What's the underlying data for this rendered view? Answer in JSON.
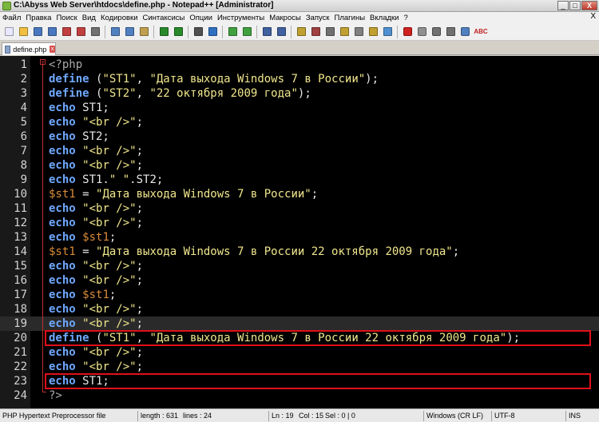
{
  "window": {
    "title": "C:\\Abyss Web Server\\htdocs\\define.php - Notepad++ [Administrator]",
    "buttons": [
      "_",
      "□",
      "X"
    ]
  },
  "menu": [
    "Файл",
    "Правка",
    "Поиск",
    "Вид",
    "Кодировки",
    "Синтаксисы",
    "Опции",
    "Инструменты",
    "Макросы",
    "Запуск",
    "Плагины",
    "Вкладки",
    "?"
  ],
  "menu_close": "X",
  "toolbar": {
    "icons": [
      "new-file-icon",
      "open-file-icon",
      "save-icon",
      "save-all-icon",
      "close-icon",
      "close-all-icon",
      "print-icon",
      "cut-icon",
      "copy-icon",
      "paste-icon",
      "undo-icon",
      "redo-icon",
      "find-icon",
      "replace-icon",
      "zoom-in-icon",
      "zoom-out-icon",
      "sync-v-icon",
      "sync-h-icon",
      "word-wrap-icon",
      "show-all-icon",
      "indent-guide-icon",
      "doc-map-icon",
      "function-list-icon",
      "folder-icon",
      "monitor-icon",
      "record-macro-icon",
      "stop-macro-icon",
      "play-macro-icon",
      "play-multi-icon",
      "save-macro-icon",
      "spellcheck-icon"
    ],
    "spellcheck_label": "ABC"
  },
  "tab": {
    "label": "define.php"
  },
  "editor": {
    "current_line": 19,
    "lines": [
      {
        "n": "1",
        "tokens": [
          [
            "phptag",
            "<?php"
          ]
        ]
      },
      {
        "n": "2",
        "tokens": [
          [
            "kw",
            "define"
          ],
          [
            "plain",
            " ("
          ],
          [
            "str",
            "\"ST1\""
          ],
          [
            "plain",
            ", "
          ],
          [
            "str",
            "\"Дата выхода Windows 7 в России\""
          ],
          [
            "plain",
            ");"
          ]
        ]
      },
      {
        "n": "3",
        "tokens": [
          [
            "kw",
            "define"
          ],
          [
            "plain",
            " ("
          ],
          [
            "str",
            "\"ST2\""
          ],
          [
            "plain",
            ", "
          ],
          [
            "str",
            "\"22 октября 2009 года\""
          ],
          [
            "plain",
            ");"
          ]
        ]
      },
      {
        "n": "4",
        "tokens": [
          [
            "kw",
            "echo"
          ],
          [
            "plain",
            " ST1;"
          ]
        ]
      },
      {
        "n": "5",
        "tokens": [
          [
            "kw",
            "echo"
          ],
          [
            "plain",
            " "
          ],
          [
            "str",
            "\"<br />\""
          ],
          [
            "plain",
            ";"
          ]
        ]
      },
      {
        "n": "6",
        "tokens": [
          [
            "kw",
            "echo"
          ],
          [
            "plain",
            " ST2;"
          ]
        ]
      },
      {
        "n": "7",
        "tokens": [
          [
            "kw",
            "echo"
          ],
          [
            "plain",
            " "
          ],
          [
            "str",
            "\"<br />\""
          ],
          [
            "plain",
            ";"
          ]
        ]
      },
      {
        "n": "8",
        "tokens": [
          [
            "kw",
            "echo"
          ],
          [
            "plain",
            " "
          ],
          [
            "str",
            "\"<br />\""
          ],
          [
            "plain",
            ";"
          ]
        ]
      },
      {
        "n": "9",
        "tokens": [
          [
            "kw",
            "echo"
          ],
          [
            "plain",
            " ST1."
          ],
          [
            "str",
            "\" \""
          ],
          [
            "plain",
            ".ST2;"
          ]
        ]
      },
      {
        "n": "10",
        "tokens": [
          [
            "var",
            "$st1"
          ],
          [
            "plain",
            " = "
          ],
          [
            "str",
            "\"Дата выхода Windows 7 в России\""
          ],
          [
            "plain",
            ";"
          ]
        ]
      },
      {
        "n": "11",
        "tokens": [
          [
            "kw",
            "echo"
          ],
          [
            "plain",
            " "
          ],
          [
            "str",
            "\"<br />\""
          ],
          [
            "plain",
            ";"
          ]
        ]
      },
      {
        "n": "12",
        "tokens": [
          [
            "kw",
            "echo"
          ],
          [
            "plain",
            " "
          ],
          [
            "str",
            "\"<br />\""
          ],
          [
            "plain",
            ";"
          ]
        ]
      },
      {
        "n": "13",
        "tokens": [
          [
            "kw",
            "echo"
          ],
          [
            "plain",
            " "
          ],
          [
            "var",
            "$st1"
          ],
          [
            "plain",
            ";"
          ]
        ]
      },
      {
        "n": "14",
        "tokens": [
          [
            "var",
            "$st1"
          ],
          [
            "plain",
            " = "
          ],
          [
            "str",
            "\"Дата выхода Windows 7 в России 22 октября 2009 года\""
          ],
          [
            "plain",
            ";"
          ]
        ]
      },
      {
        "n": "15",
        "tokens": [
          [
            "kw",
            "echo"
          ],
          [
            "plain",
            " "
          ],
          [
            "str",
            "\"<br />\""
          ],
          [
            "plain",
            ";"
          ]
        ]
      },
      {
        "n": "16",
        "tokens": [
          [
            "kw",
            "echo"
          ],
          [
            "plain",
            " "
          ],
          [
            "str",
            "\"<br />\""
          ],
          [
            "plain",
            ";"
          ]
        ]
      },
      {
        "n": "17",
        "tokens": [
          [
            "kw",
            "echo"
          ],
          [
            "plain",
            " "
          ],
          [
            "var",
            "$st1"
          ],
          [
            "plain",
            ";"
          ]
        ]
      },
      {
        "n": "18",
        "tokens": [
          [
            "kw",
            "echo"
          ],
          [
            "plain",
            " "
          ],
          [
            "str",
            "\"<br />\""
          ],
          [
            "plain",
            ";"
          ]
        ]
      },
      {
        "n": "19",
        "tokens": [
          [
            "kw",
            "echo"
          ],
          [
            "plain",
            " "
          ],
          [
            "str",
            "\"<br />\""
          ],
          [
            "plain",
            ";"
          ]
        ]
      },
      {
        "n": "20",
        "tokens": [
          [
            "kw",
            "define"
          ],
          [
            "plain",
            " ("
          ],
          [
            "str",
            "\"ST1\""
          ],
          [
            "plain",
            ", "
          ],
          [
            "str",
            "\"Дата выхода Windows 7 в России 22 октября 2009 года\""
          ],
          [
            "plain",
            ");"
          ]
        ]
      },
      {
        "n": "21",
        "tokens": [
          [
            "kw",
            "echo"
          ],
          [
            "plain",
            " "
          ],
          [
            "str",
            "\"<br />\""
          ],
          [
            "plain",
            ";"
          ]
        ]
      },
      {
        "n": "22",
        "tokens": [
          [
            "kw",
            "echo"
          ],
          [
            "plain",
            " "
          ],
          [
            "str",
            "\"<br />\""
          ],
          [
            "plain",
            ";"
          ]
        ]
      },
      {
        "n": "23",
        "tokens": [
          [
            "kw",
            "echo"
          ],
          [
            "plain",
            " ST1;"
          ]
        ]
      },
      {
        "n": "24",
        "tokens": [
          [
            "phptag",
            "?>"
          ]
        ]
      }
    ],
    "highlighted_lines": [
      20,
      23
    ],
    "colors": {
      "keyword": "#6fa8ff",
      "string": "#f0e68c",
      "variable": "#d98c3a",
      "highlight_box": "#e0101a",
      "background": "#000000"
    }
  },
  "status": {
    "file_type": "PHP Hypertext Preprocessor file",
    "length": "length : 631",
    "lines": "lines : 24",
    "ln": "Ln : 19",
    "col": "Col : 15",
    "sel": "Sel : 0 | 0",
    "eol": "Windows (CR LF)",
    "encoding": "UTF-8",
    "mode": "INS"
  }
}
